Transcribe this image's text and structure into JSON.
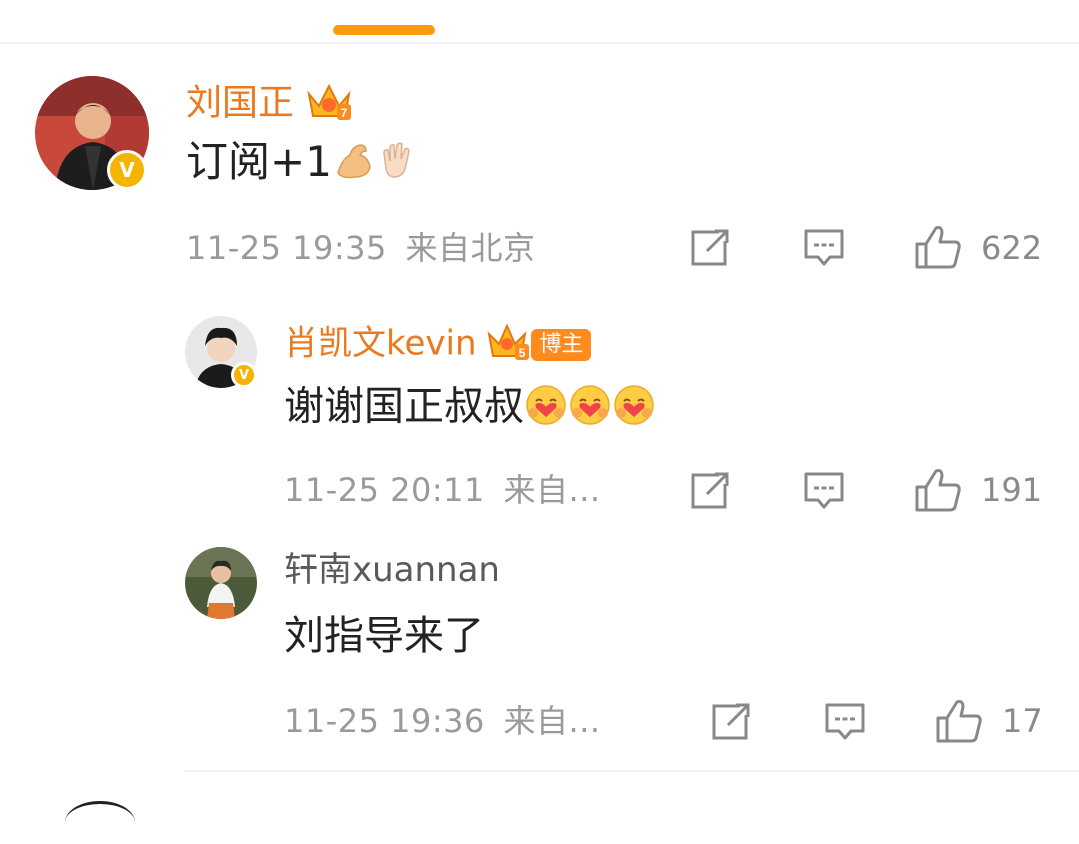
{
  "comments": [
    {
      "user": "刘国正",
      "level": "7",
      "text": "订阅+1",
      "emojis": [
        "flexed-biceps",
        "waving-hand"
      ],
      "time": "11-25 19:35",
      "location": "来自北京",
      "likes": "622"
    },
    {
      "user": "肖凯文kevin",
      "level": "5",
      "tag": "博主",
      "text": "谢谢国正叔叔",
      "emojis": [
        "hugging-heart-face",
        "hugging-heart-face",
        "hugging-heart-face"
      ],
      "time": "11-25 20:11",
      "location": "来自...",
      "likes": "191"
    },
    {
      "user": "轩南xuannan",
      "text": "刘指导来了",
      "time": "11-25 19:36",
      "location": "来自...",
      "likes": "17"
    }
  ],
  "colors": {
    "accent": "#ff9a0e",
    "username": "#eb7a1f",
    "verified": "#f5b400",
    "meta": "#9a9a9a"
  }
}
